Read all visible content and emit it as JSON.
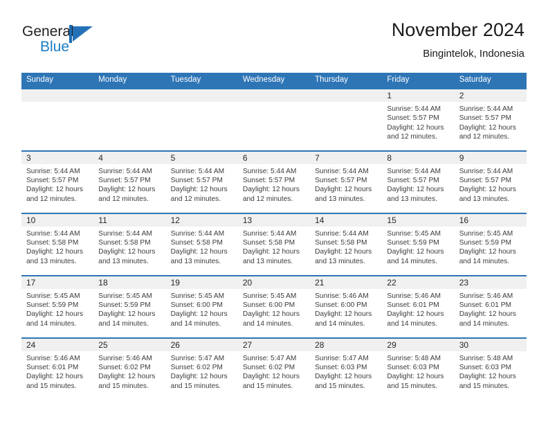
{
  "brand": {
    "name_part1": "General",
    "name_part2": "Blue",
    "logo_icon": "general-blue-flag-logo",
    "color_text": "#231f20",
    "color_blue": "#1a7dc4"
  },
  "header": {
    "title": "November 2024",
    "subtitle": "Bingintelok, Indonesia"
  },
  "theme": {
    "header_bg": "#2e75b6",
    "header_text": "#ffffff",
    "daynum_band_bg": "#f0f0f0",
    "body_text": "#3b3b3b",
    "page_bg": "#ffffff"
  },
  "weekday_headers": [
    "Sunday",
    "Monday",
    "Tuesday",
    "Wednesday",
    "Thursday",
    "Friday",
    "Saturday"
  ],
  "weeks": [
    [
      {
        "day": "",
        "empty": true,
        "sunrise": "",
        "sunset": "",
        "daylight_line1": "",
        "daylight_line2": ""
      },
      {
        "day": "",
        "empty": true,
        "sunrise": "",
        "sunset": "",
        "daylight_line1": "",
        "daylight_line2": ""
      },
      {
        "day": "",
        "empty": true,
        "sunrise": "",
        "sunset": "",
        "daylight_line1": "",
        "daylight_line2": ""
      },
      {
        "day": "",
        "empty": true,
        "sunrise": "",
        "sunset": "",
        "daylight_line1": "",
        "daylight_line2": ""
      },
      {
        "day": "",
        "empty": true,
        "sunrise": "",
        "sunset": "",
        "daylight_line1": "",
        "daylight_line2": ""
      },
      {
        "day": "1",
        "empty": false,
        "sunrise": "Sunrise: 5:44 AM",
        "sunset": "Sunset: 5:57 PM",
        "daylight_line1": "Daylight: 12 hours",
        "daylight_line2": "and 12 minutes."
      },
      {
        "day": "2",
        "empty": false,
        "sunrise": "Sunrise: 5:44 AM",
        "sunset": "Sunset: 5:57 PM",
        "daylight_line1": "Daylight: 12 hours",
        "daylight_line2": "and 12 minutes."
      }
    ],
    [
      {
        "day": "3",
        "empty": false,
        "sunrise": "Sunrise: 5:44 AM",
        "sunset": "Sunset: 5:57 PM",
        "daylight_line1": "Daylight: 12 hours",
        "daylight_line2": "and 12 minutes."
      },
      {
        "day": "4",
        "empty": false,
        "sunrise": "Sunrise: 5:44 AM",
        "sunset": "Sunset: 5:57 PM",
        "daylight_line1": "Daylight: 12 hours",
        "daylight_line2": "and 12 minutes."
      },
      {
        "day": "5",
        "empty": false,
        "sunrise": "Sunrise: 5:44 AM",
        "sunset": "Sunset: 5:57 PM",
        "daylight_line1": "Daylight: 12 hours",
        "daylight_line2": "and 12 minutes."
      },
      {
        "day": "6",
        "empty": false,
        "sunrise": "Sunrise: 5:44 AM",
        "sunset": "Sunset: 5:57 PM",
        "daylight_line1": "Daylight: 12 hours",
        "daylight_line2": "and 12 minutes."
      },
      {
        "day": "7",
        "empty": false,
        "sunrise": "Sunrise: 5:44 AM",
        "sunset": "Sunset: 5:57 PM",
        "daylight_line1": "Daylight: 12 hours",
        "daylight_line2": "and 13 minutes."
      },
      {
        "day": "8",
        "empty": false,
        "sunrise": "Sunrise: 5:44 AM",
        "sunset": "Sunset: 5:57 PM",
        "daylight_line1": "Daylight: 12 hours",
        "daylight_line2": "and 13 minutes."
      },
      {
        "day": "9",
        "empty": false,
        "sunrise": "Sunrise: 5:44 AM",
        "sunset": "Sunset: 5:57 PM",
        "daylight_line1": "Daylight: 12 hours",
        "daylight_line2": "and 13 minutes."
      }
    ],
    [
      {
        "day": "10",
        "empty": false,
        "sunrise": "Sunrise: 5:44 AM",
        "sunset": "Sunset: 5:58 PM",
        "daylight_line1": "Daylight: 12 hours",
        "daylight_line2": "and 13 minutes."
      },
      {
        "day": "11",
        "empty": false,
        "sunrise": "Sunrise: 5:44 AM",
        "sunset": "Sunset: 5:58 PM",
        "daylight_line1": "Daylight: 12 hours",
        "daylight_line2": "and 13 minutes."
      },
      {
        "day": "12",
        "empty": false,
        "sunrise": "Sunrise: 5:44 AM",
        "sunset": "Sunset: 5:58 PM",
        "daylight_line1": "Daylight: 12 hours",
        "daylight_line2": "and 13 minutes."
      },
      {
        "day": "13",
        "empty": false,
        "sunrise": "Sunrise: 5:44 AM",
        "sunset": "Sunset: 5:58 PM",
        "daylight_line1": "Daylight: 12 hours",
        "daylight_line2": "and 13 minutes."
      },
      {
        "day": "14",
        "empty": false,
        "sunrise": "Sunrise: 5:44 AM",
        "sunset": "Sunset: 5:58 PM",
        "daylight_line1": "Daylight: 12 hours",
        "daylight_line2": "and 13 minutes."
      },
      {
        "day": "15",
        "empty": false,
        "sunrise": "Sunrise: 5:45 AM",
        "sunset": "Sunset: 5:59 PM",
        "daylight_line1": "Daylight: 12 hours",
        "daylight_line2": "and 14 minutes."
      },
      {
        "day": "16",
        "empty": false,
        "sunrise": "Sunrise: 5:45 AM",
        "sunset": "Sunset: 5:59 PM",
        "daylight_line1": "Daylight: 12 hours",
        "daylight_line2": "and 14 minutes."
      }
    ],
    [
      {
        "day": "17",
        "empty": false,
        "sunrise": "Sunrise: 5:45 AM",
        "sunset": "Sunset: 5:59 PM",
        "daylight_line1": "Daylight: 12 hours",
        "daylight_line2": "and 14 minutes."
      },
      {
        "day": "18",
        "empty": false,
        "sunrise": "Sunrise: 5:45 AM",
        "sunset": "Sunset: 5:59 PM",
        "daylight_line1": "Daylight: 12 hours",
        "daylight_line2": "and 14 minutes."
      },
      {
        "day": "19",
        "empty": false,
        "sunrise": "Sunrise: 5:45 AM",
        "sunset": "Sunset: 6:00 PM",
        "daylight_line1": "Daylight: 12 hours",
        "daylight_line2": "and 14 minutes."
      },
      {
        "day": "20",
        "empty": false,
        "sunrise": "Sunrise: 5:45 AM",
        "sunset": "Sunset: 6:00 PM",
        "daylight_line1": "Daylight: 12 hours",
        "daylight_line2": "and 14 minutes."
      },
      {
        "day": "21",
        "empty": false,
        "sunrise": "Sunrise: 5:46 AM",
        "sunset": "Sunset: 6:00 PM",
        "daylight_line1": "Daylight: 12 hours",
        "daylight_line2": "and 14 minutes."
      },
      {
        "day": "22",
        "empty": false,
        "sunrise": "Sunrise: 5:46 AM",
        "sunset": "Sunset: 6:01 PM",
        "daylight_line1": "Daylight: 12 hours",
        "daylight_line2": "and 14 minutes."
      },
      {
        "day": "23",
        "empty": false,
        "sunrise": "Sunrise: 5:46 AM",
        "sunset": "Sunset: 6:01 PM",
        "daylight_line1": "Daylight: 12 hours",
        "daylight_line2": "and 14 minutes."
      }
    ],
    [
      {
        "day": "24",
        "empty": false,
        "sunrise": "Sunrise: 5:46 AM",
        "sunset": "Sunset: 6:01 PM",
        "daylight_line1": "Daylight: 12 hours",
        "daylight_line2": "and 15 minutes."
      },
      {
        "day": "25",
        "empty": false,
        "sunrise": "Sunrise: 5:46 AM",
        "sunset": "Sunset: 6:02 PM",
        "daylight_line1": "Daylight: 12 hours",
        "daylight_line2": "and 15 minutes."
      },
      {
        "day": "26",
        "empty": false,
        "sunrise": "Sunrise: 5:47 AM",
        "sunset": "Sunset: 6:02 PM",
        "daylight_line1": "Daylight: 12 hours",
        "daylight_line2": "and 15 minutes."
      },
      {
        "day": "27",
        "empty": false,
        "sunrise": "Sunrise: 5:47 AM",
        "sunset": "Sunset: 6:02 PM",
        "daylight_line1": "Daylight: 12 hours",
        "daylight_line2": "and 15 minutes."
      },
      {
        "day": "28",
        "empty": false,
        "sunrise": "Sunrise: 5:47 AM",
        "sunset": "Sunset: 6:03 PM",
        "daylight_line1": "Daylight: 12 hours",
        "daylight_line2": "and 15 minutes."
      },
      {
        "day": "29",
        "empty": false,
        "sunrise": "Sunrise: 5:48 AM",
        "sunset": "Sunset: 6:03 PM",
        "daylight_line1": "Daylight: 12 hours",
        "daylight_line2": "and 15 minutes."
      },
      {
        "day": "30",
        "empty": false,
        "sunrise": "Sunrise: 5:48 AM",
        "sunset": "Sunset: 6:03 PM",
        "daylight_line1": "Daylight: 12 hours",
        "daylight_line2": "and 15 minutes."
      }
    ]
  ]
}
